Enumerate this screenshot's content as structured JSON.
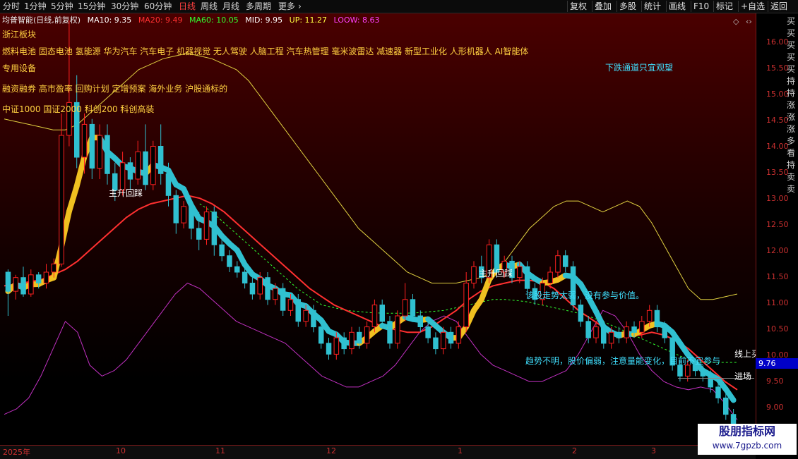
{
  "toolbar": {
    "periods": [
      "分时",
      "1分钟",
      "5分钟",
      "15分钟",
      "30分钟",
      "60分钟",
      "日线",
      "周线",
      "月线",
      "多周期",
      "更多"
    ],
    "active_period": "日线",
    "right_buttons": [
      "复权",
      "叠加",
      "多股",
      "统计",
      "画线",
      "F10",
      "标记",
      "+自选",
      "返回"
    ]
  },
  "header": {
    "title": "均普智能(日线,前复权)",
    "indicators": [
      {
        "label": "MA10: 9.35",
        "color": "#ffffff"
      },
      {
        "label": "MA20: 9.49",
        "color": "#ff3030"
      },
      {
        "label": "MA60: 10.05",
        "color": "#30ff30"
      },
      {
        "label": "MID: 9.95",
        "color": "#ffffff"
      },
      {
        "label": "UP: 11.27",
        "color": "#ffff40"
      },
      {
        "label": "LOOW: 8.63",
        "color": "#ff40ff"
      }
    ]
  },
  "annotations": {
    "sector": "浙江板块",
    "concepts1": "燃料电池 固态电池 氢能源 华为汽车 汽车电子 机器视觉 无人驾驶 人脑工程 汽车热管理 毫米波雷达 减速器 新型工业化 人形机器人 AI智能体",
    "concepts2": "专用设备",
    "concepts3": "融资融券 高市盈率 回购计划 定增预案 海外业务 沪股通标的",
    "concepts4": "中证1000 国证2000 科创200 科创高装",
    "downtrend": "下跌通道只宜观望",
    "pullback1": "主升回踩",
    "pullback2": "主升回踩",
    "weak": "该股走势太弱，没有参与价值。",
    "unclear": "趋势不明，股价偏弱，注意量能变化，目前不宜参与",
    "line_up": "线上买",
    "enter": "进场"
  },
  "axis": {
    "ticks": [
      "16.00",
      "15.50",
      "15.00",
      "14.50",
      "14.00",
      "13.50",
      "13.00",
      "12.50",
      "12.00",
      "11.50",
      "11.00",
      "10.50",
      "10.00",
      "9.50",
      "9.00"
    ],
    "current_price": "9.76",
    "dates": [
      "2025年",
      "10",
      "11",
      "12",
      "1",
      "2",
      "3"
    ]
  },
  "vertical_strip": "买买买买买持持涨涨涨多看持卖卖",
  "watermark": {
    "name": "股朋指标网",
    "url": "www.7gpzb.com"
  },
  "colors": {
    "up": "#ff2020",
    "down": "#30c0d0",
    "ma10": "#ffffff",
    "ma20": "#ff3030",
    "ma60": "#30ff30",
    "up_band": "#e0d040",
    "low_band": "#c030c0",
    "accent": "#ff4040"
  },
  "chart_data": {
    "type": "candlestick",
    "ylim": [
      8.8,
      16.3
    ],
    "dates": [
      "2025-09",
      "2025-10",
      "2025-11",
      "2025-12",
      "2026-01",
      "2026-02",
      "2026-03"
    ],
    "candles": [
      [
        11.7,
        11.35,
        11.75,
        10.9
      ],
      [
        11.35,
        11.6,
        11.65,
        11.2
      ],
      [
        11.6,
        11.3,
        11.8,
        11.25
      ],
      [
        11.3,
        11.65,
        11.75,
        11.25
      ],
      [
        11.65,
        11.5,
        11.7,
        11.4
      ],
      [
        11.5,
        11.7,
        11.85,
        11.4
      ],
      [
        11.7,
        11.85,
        11.95,
        11.6
      ],
      [
        11.85,
        14.2,
        14.6,
        11.8
      ],
      [
        14.2,
        14.8,
        16.3,
        14.0
      ],
      [
        14.8,
        13.8,
        15.3,
        13.6
      ],
      [
        13.8,
        14.4,
        14.6,
        13.5
      ],
      [
        14.4,
        13.6,
        14.5,
        13.4
      ],
      [
        13.6,
        14.2,
        14.4,
        13.4
      ],
      [
        14.2,
        13.5,
        14.4,
        13.3
      ],
      [
        13.5,
        13.2,
        13.7,
        13.0
      ],
      [
        13.2,
        13.7,
        13.9,
        13.1
      ],
      [
        13.7,
        13.4,
        13.8,
        13.2
      ],
      [
        13.4,
        13.9,
        14.1,
        13.3
      ],
      [
        13.9,
        13.3,
        14.4,
        13.2
      ],
      [
        13.3,
        14.0,
        14.1,
        13.2
      ],
      [
        14.0,
        13.5,
        14.4,
        13.3
      ],
      [
        13.5,
        13.1,
        13.7,
        12.9
      ],
      [
        13.1,
        12.6,
        13.2,
        12.4
      ],
      [
        12.6,
        12.9,
        13.0,
        12.5
      ],
      [
        12.9,
        12.5,
        13.0,
        12.3
      ],
      [
        12.5,
        12.3,
        12.8,
        12.1
      ],
      [
        12.3,
        12.8,
        12.9,
        12.2
      ],
      [
        12.8,
        12.2,
        12.9,
        12.0
      ],
      [
        12.2,
        12.0,
        12.3,
        11.9
      ],
      [
        12.0,
        11.8,
        12.1,
        11.7
      ],
      [
        11.8,
        11.7,
        11.9,
        11.6
      ],
      [
        11.7,
        11.5,
        11.8,
        11.4
      ],
      [
        11.5,
        11.3,
        11.6,
        11.2
      ],
      [
        11.3,
        11.6,
        11.7,
        11.2
      ],
      [
        11.6,
        11.2,
        11.7,
        11.1
      ],
      [
        11.2,
        11.4,
        11.5,
        11.1
      ],
      [
        11.4,
        11.0,
        11.5,
        10.9
      ],
      [
        11.0,
        11.2,
        11.3,
        10.9
      ],
      [
        11.2,
        10.8,
        11.3,
        10.7
      ],
      [
        10.8,
        11.0,
        11.1,
        10.7
      ],
      [
        11.0,
        10.7,
        11.1,
        10.6
      ],
      [
        10.7,
        10.4,
        10.8,
        10.3
      ],
      [
        10.4,
        10.2,
        10.5,
        10.1
      ],
      [
        10.2,
        10.5,
        10.6,
        10.1
      ],
      [
        10.5,
        10.3,
        10.6,
        10.2
      ],
      [
        10.3,
        10.6,
        10.7,
        10.2
      ],
      [
        10.6,
        10.4,
        10.7,
        10.3
      ],
      [
        10.4,
        10.7,
        10.8,
        10.3
      ],
      [
        10.7,
        11.1,
        11.2,
        10.6
      ],
      [
        11.1,
        10.8,
        11.2,
        10.7
      ],
      [
        10.8,
        10.4,
        10.9,
        10.3
      ],
      [
        10.4,
        10.9,
        11.0,
        10.3
      ],
      [
        10.9,
        11.2,
        11.5,
        10.8
      ],
      [
        11.2,
        10.9,
        11.3,
        10.8
      ],
      [
        10.9,
        10.7,
        11.0,
        10.6
      ],
      [
        10.7,
        10.5,
        10.8,
        10.4
      ],
      [
        10.5,
        10.3,
        10.6,
        10.2
      ],
      [
        10.3,
        10.6,
        10.7,
        10.2
      ],
      [
        10.6,
        10.4,
        10.7,
        10.3
      ],
      [
        10.4,
        10.7,
        10.8,
        10.3
      ],
      [
        10.7,
        11.5,
        11.7,
        10.6
      ],
      [
        11.5,
        11.8,
        11.9,
        11.4
      ],
      [
        11.8,
        11.6,
        12.0,
        11.5
      ],
      [
        11.6,
        12.2,
        12.3,
        11.5
      ],
      [
        12.2,
        11.7,
        12.3,
        11.6
      ],
      [
        11.7,
        11.9,
        12.0,
        11.6
      ],
      [
        11.9,
        11.6,
        12.0,
        11.5
      ],
      [
        11.6,
        11.8,
        11.9,
        11.5
      ],
      [
        11.8,
        11.4,
        11.9,
        11.3
      ],
      [
        11.4,
        11.2,
        11.5,
        11.1
      ],
      [
        11.2,
        11.5,
        11.6,
        11.1
      ],
      [
        11.5,
        11.7,
        11.8,
        11.4
      ],
      [
        11.7,
        12.0,
        12.1,
        11.6
      ],
      [
        12.0,
        11.8,
        12.1,
        11.7
      ],
      [
        11.8,
        11.1,
        11.9,
        11.0
      ],
      [
        11.1,
        10.8,
        11.2,
        10.7
      ],
      [
        10.8,
        10.5,
        10.9,
        10.4
      ],
      [
        10.5,
        10.7,
        10.8,
        10.4
      ],
      [
        10.7,
        10.4,
        10.8,
        10.3
      ],
      [
        10.4,
        10.6,
        10.7,
        10.3
      ],
      [
        10.6,
        10.5,
        10.7,
        10.4
      ],
      [
        10.5,
        10.7,
        10.8,
        10.4
      ],
      [
        10.7,
        10.6,
        10.8,
        10.5
      ],
      [
        10.6,
        10.8,
        10.9,
        10.5
      ],
      [
        10.8,
        11.0,
        11.1,
        10.7
      ],
      [
        11.0,
        10.7,
        11.1,
        10.6
      ],
      [
        10.7,
        10.5,
        10.8,
        10.4
      ],
      [
        10.5,
        10.0,
        10.6,
        9.9
      ],
      [
        10.0,
        9.8,
        10.1,
        9.7
      ],
      [
        9.8,
        10.0,
        10.1,
        9.7
      ],
      [
        10.0,
        9.9,
        10.1,
        9.8
      ],
      [
        9.9,
        9.8,
        10.0,
        9.7
      ],
      [
        9.8,
        9.6,
        9.9,
        9.5
      ],
      [
        9.6,
        9.4,
        9.7,
        9.3
      ],
      [
        9.4,
        9.1,
        9.5,
        9.0
      ],
      [
        9.1,
        8.9,
        9.2,
        8.85
      ]
    ],
    "up_band": [
      14.5,
      14.45,
      14.4,
      14.35,
      14.3,
      14.3,
      14.4,
      14.6,
      14.8,
      15.0,
      15.2,
      15.4,
      15.5,
      15.6,
      15.65,
      15.7,
      15.65,
      15.6,
      15.5,
      15.4,
      15.2,
      14.9,
      14.6,
      14.3,
      14.0,
      13.7,
      13.4,
      13.1,
      12.8,
      12.5,
      12.3,
      12.1,
      11.9,
      11.7,
      11.6,
      11.5,
      11.5,
      11.5,
      11.55,
      11.6,
      11.7,
      11.9,
      12.2,
      12.5,
      12.7,
      12.9,
      13.0,
      13.0,
      12.9,
      12.8,
      12.9,
      13.0,
      12.9,
      12.6,
      12.2,
      11.8,
      11.4,
      11.2,
      11.2,
      11.25,
      11.3
    ],
    "low_band": [
      9.1,
      9.2,
      9.4,
      9.8,
      10.3,
      10.8,
      10.6,
      10.0,
      9.8,
      9.9,
      10.1,
      10.4,
      10.7,
      11.0,
      11.3,
      11.5,
      11.4,
      11.2,
      11.0,
      10.8,
      10.7,
      10.6,
      10.5,
      10.4,
      10.2,
      10.0,
      9.8,
      9.7,
      9.6,
      9.6,
      9.7,
      9.8,
      10.0,
      10.3,
      10.6,
      10.8,
      10.9,
      10.8,
      10.5,
      10.2,
      10.0,
      9.9,
      9.8,
      9.7,
      9.7,
      9.8,
      9.9,
      10.2,
      10.6,
      11.0,
      10.9,
      10.6,
      10.2,
      9.9,
      9.7,
      9.6,
      9.55,
      9.6,
      9.55,
      9.3,
      9.0
    ],
    "ma20": [
      11.45,
      11.48,
      11.52,
      11.56,
      11.65,
      11.75,
      11.9,
      12.1,
      12.3,
      12.5,
      12.7,
      12.85,
      12.95,
      13.0,
      13.05,
      13.1,
      13.05,
      12.95,
      12.8,
      12.6,
      12.4,
      12.2,
      12.0,
      11.8,
      11.6,
      11.4,
      11.25,
      11.1,
      11.0,
      10.9,
      10.8,
      10.7,
      10.65,
      10.6,
      10.6,
      10.7,
      10.85,
      11.0,
      11.2,
      11.35,
      11.45,
      11.5,
      11.55,
      11.55,
      11.52,
      11.4,
      11.2,
      11.0,
      10.85,
      10.7,
      10.6,
      10.55,
      10.55,
      10.6,
      10.55,
      10.45,
      10.3,
      10.1,
      9.9,
      9.7,
      9.55
    ],
    "ma60": [
      null,
      null,
      null,
      null,
      null,
      null,
      null,
      null,
      null,
      null,
      null,
      null,
      null,
      null,
      null,
      null,
      12.95,
      12.8,
      12.6,
      12.4,
      12.2,
      12.0,
      11.8,
      11.6,
      11.4,
      11.25,
      11.1,
      11.05,
      11.0,
      10.98,
      10.96,
      10.95,
      10.95,
      10.95,
      10.96,
      10.98,
      11.0,
      11.05,
      11.1,
      11.15,
      11.2,
      11.2,
      11.18,
      11.15,
      11.1,
      11.05,
      11.0,
      10.95,
      10.88,
      10.8,
      10.7,
      10.6,
      10.5,
      10.4,
      10.3,
      10.2,
      10.1,
      10.05,
      10.05,
      10.05,
      10.05
    ]
  }
}
